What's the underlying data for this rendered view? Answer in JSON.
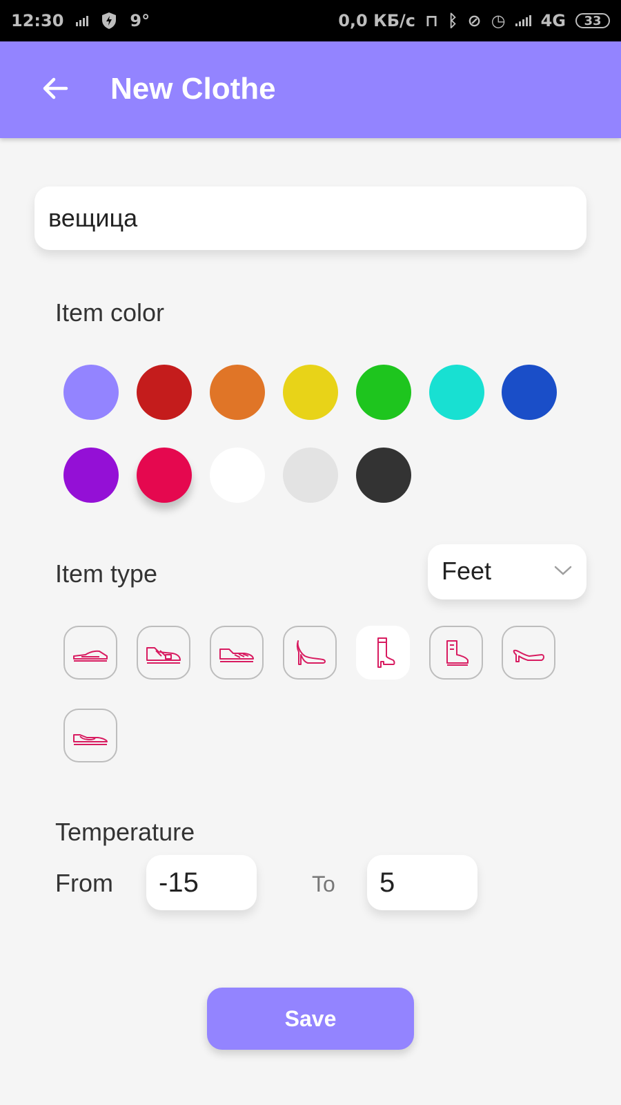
{
  "status_bar": {
    "time": "12:30",
    "temp": "9°",
    "network_speed": "0,0 КБ/с",
    "network_type": "4G",
    "battery": "33"
  },
  "app_bar": {
    "title": "New Clothe",
    "back_icon": "arrow-left-icon",
    "background": "#9384ff"
  },
  "name_field": {
    "value": "вещица"
  },
  "color_section": {
    "label": "Item color",
    "selected": "#e5084f",
    "swatches": [
      "#9384ff",
      "#c41c1c",
      "#e07527",
      "#e8d318",
      "#1ec51e",
      "#18e0d2",
      "#1a4ec8",
      "#9410d6",
      "#e5084f",
      "#ffffff",
      "#e3e3e3",
      "#333333"
    ]
  },
  "type_section": {
    "label": "Item type",
    "category": "Feet",
    "selected_icon": "boot-icon",
    "icons": [
      "flat-shoe-icon",
      "strap-sneaker-icon",
      "running-shoe-icon",
      "high-heel-icon",
      "boot-icon",
      "ankle-boot-icon",
      "low-heel-icon",
      "slip-on-icon"
    ],
    "icon_color": "#d81b60"
  },
  "temperature": {
    "label": "Temperature",
    "from_label": "From",
    "from_value": "-15",
    "to_label": "To",
    "to_value": "5"
  },
  "save_label": "Save"
}
